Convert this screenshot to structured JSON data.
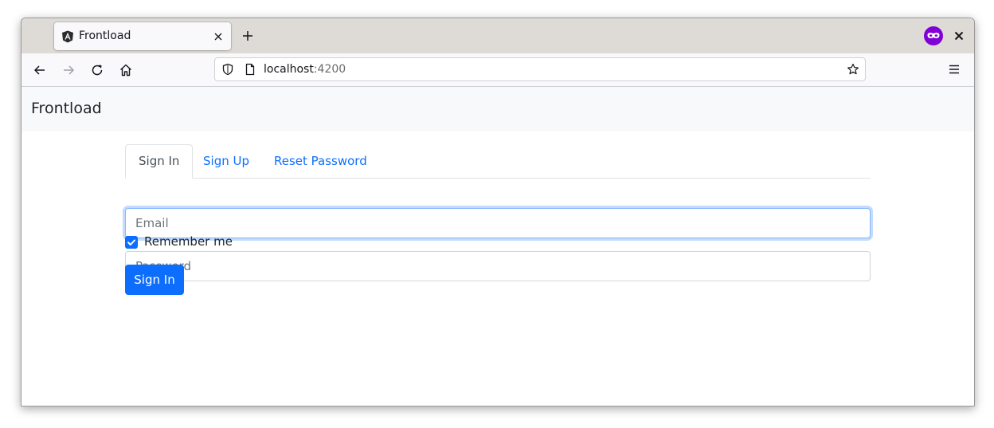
{
  "browser": {
    "tab_title": "Frontload",
    "url_host": "localhost",
    "url_port": ":4200",
    "colors": {
      "private_icon": "#8000d7",
      "tab_strip": "#dedbd7"
    }
  },
  "app": {
    "brand": "Frontload",
    "tabs": [
      {
        "label": "Sign In",
        "active": true
      },
      {
        "label": "Sign Up",
        "active": false
      },
      {
        "label": "Reset Password",
        "active": false
      }
    ],
    "email": {
      "placeholder": "Email",
      "value": ""
    },
    "password": {
      "placeholder": "Password",
      "value": ""
    },
    "remember": {
      "label": "Remember me",
      "checked": true
    },
    "submit_label": "Sign In",
    "colors": {
      "primary": "#0d6efd",
      "navbar_bg": "#f8f9fa"
    }
  },
  "icons": {
    "tab_favicon": "angular-icon",
    "tab_close": "close-icon",
    "new_tab": "plus-icon",
    "private": "private-browsing-icon",
    "window_close": "close-icon",
    "back": "arrow-left-icon",
    "forward": "arrow-right-icon",
    "reload": "reload-icon",
    "home": "home-icon",
    "shield": "shield-icon",
    "page": "page-icon",
    "bookmark": "star-icon",
    "menu": "hamburger-icon",
    "checkbox": "checkmark-icon"
  }
}
